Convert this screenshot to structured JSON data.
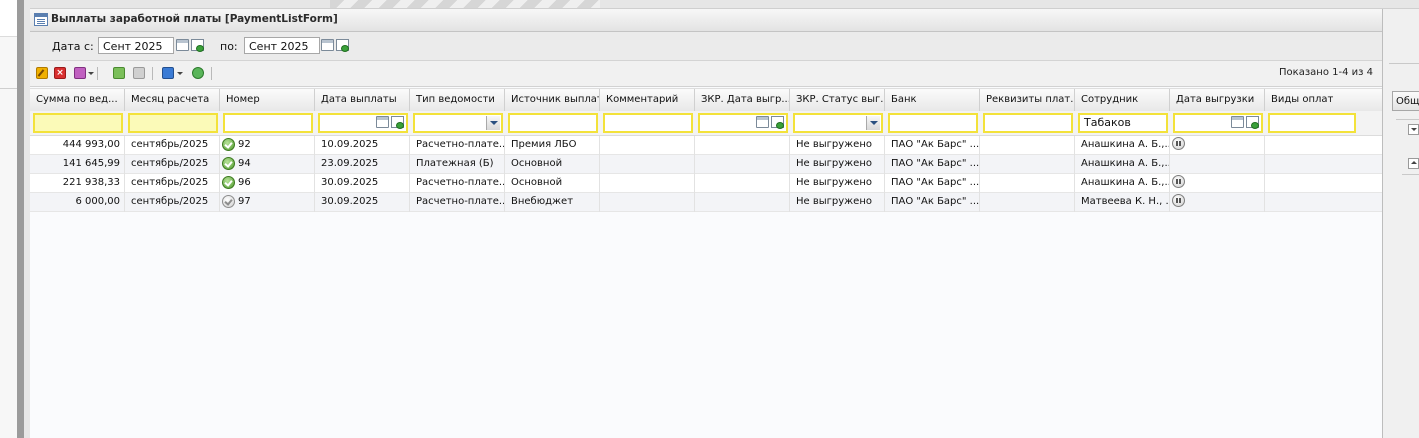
{
  "window": {
    "title": "Выплаты заработной платы [PaymentListForm]"
  },
  "filters": {
    "date_from_label": "Дата с:",
    "date_from_value": "Сент 2025",
    "date_to_label": "по:",
    "date_to_value": "Сент 2025"
  },
  "toolbar": {
    "shown_text": "Показано 1-4 из 4"
  },
  "columns": [
    "Сумма по вед...",
    "Месяц расчета",
    "Номер",
    "Дата выплаты",
    "Тип ведомости",
    "Источник выплат",
    "Комментарий",
    "ЗКР. Дата выгр...",
    "ЗКР. Статус выг...",
    "Банк",
    "Реквизиты плат...",
    "Сотрудник",
    "Дата выгрузки",
    "Виды оплат"
  ],
  "column_filters": {
    "employee": "Табаков"
  },
  "rows": [
    {
      "sum": "444 993,00",
      "month": "сентябрь/2025",
      "number": "92",
      "status": "ok",
      "pay_date": "10.09.2025",
      "type": "Расчетно-плате...",
      "source": "Премия ЛБО",
      "comment": "",
      "zkr_date": "",
      "zkr_status": "Не выгружено",
      "bank": "ПАО \"Ак Барс\" ...",
      "requisites": "",
      "employee": "Анашкина А. Б.,...",
      "export_date_icon": "pause-icon",
      "pay_kinds": ""
    },
    {
      "sum": "141 645,99",
      "month": "сентябрь/2025",
      "number": "94",
      "status": "ok",
      "pay_date": "23.09.2025",
      "type": "Платежная (Б)",
      "source": "Основной",
      "comment": "",
      "zkr_date": "",
      "zkr_status": "Не выгружено",
      "bank": "ПАО \"Ак Барс\" ...",
      "requisites": "",
      "employee": "Анашкина А. Б.,...",
      "export_date_icon": "",
      "pay_kinds": ""
    },
    {
      "sum": "221 938,33",
      "month": "сентябрь/2025",
      "number": "96",
      "status": "ok",
      "pay_date": "30.09.2025",
      "type": "Расчетно-плате...",
      "source": "Основной",
      "comment": "",
      "zkr_date": "",
      "zkr_status": "Не выгружено",
      "bank": "ПАО \"Ак Барс\" ...",
      "requisites": "",
      "employee": "Анашкина А. Б.,...",
      "export_date_icon": "pause-icon",
      "pay_kinds": ""
    },
    {
      "sum": "6 000,00",
      "month": "сентябрь/2025",
      "number": "97",
      "status": "grey",
      "pay_date": "30.09.2025",
      "type": "Расчетно-плате...",
      "source": "Внебюджет",
      "comment": "",
      "zkr_date": "",
      "zkr_status": "Не выгружено",
      "bank": "ПАО \"Ак Барс\" ...",
      "requisites": "",
      "employee": "Матвеева К. Н., ...",
      "export_date_icon": "pause-icon",
      "pay_kinds": ""
    }
  ],
  "right_panel": {
    "tab_label": "Общ"
  },
  "colors": {
    "filter_highlight": "#f3e23a",
    "filter_fill": "#fbfab8",
    "status_ok": "#4f9a2c"
  }
}
